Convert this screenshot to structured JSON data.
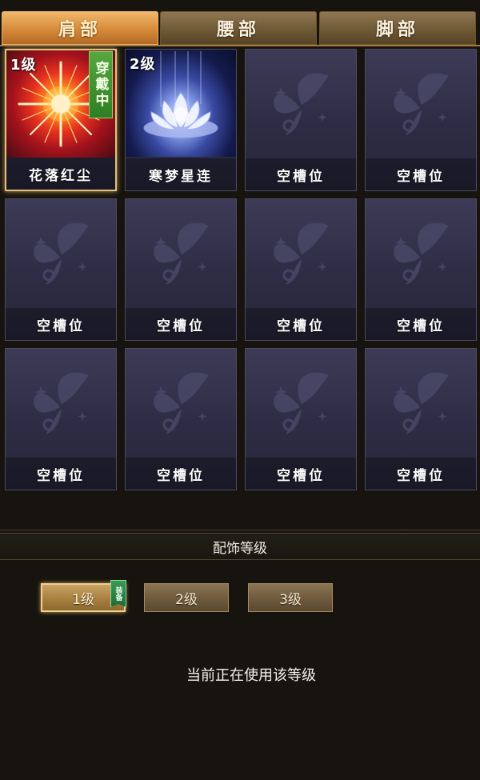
{
  "tabs": [
    {
      "label": "肩部",
      "active": true
    },
    {
      "label": "腰部",
      "active": false
    },
    {
      "label": "脚部",
      "active": false
    }
  ],
  "slots": [
    {
      "name": "花落红尘",
      "level": "1级",
      "badge": "穿戴中",
      "art": "fire"
    },
    {
      "name": "寒梦星连",
      "level": "2级",
      "art": "lotus"
    },
    {
      "name": "空槽位"
    },
    {
      "name": "空槽位"
    },
    {
      "name": "空槽位"
    },
    {
      "name": "空槽位"
    },
    {
      "name": "空槽位"
    },
    {
      "name": "空槽位"
    },
    {
      "name": "空槽位"
    },
    {
      "name": "空槽位"
    },
    {
      "name": "空槽位"
    },
    {
      "name": "空槽位"
    }
  ],
  "section": {
    "title": "配饰等级",
    "levels": [
      {
        "label": "1级",
        "active": true,
        "tag": "装备"
      },
      {
        "label": "2级",
        "active": false
      },
      {
        "label": "3级",
        "active": false
      }
    ],
    "status": "当前正在使用该等级"
  },
  "colors": {
    "accent": "#d78a3a",
    "badge_green": "#3d9a2e",
    "slot_bg": "#2e2c44",
    "page_bg": "#17140f"
  }
}
